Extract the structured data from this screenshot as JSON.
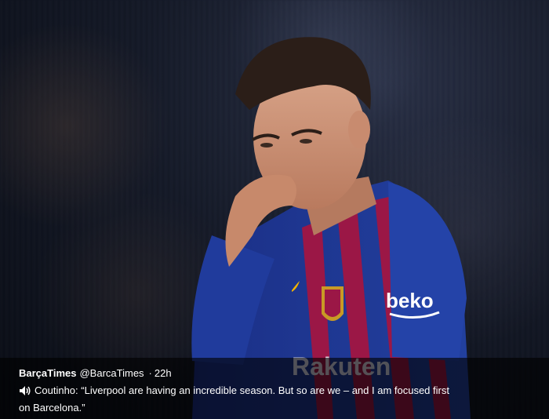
{
  "tweet": {
    "author_name": "BarçaTimes",
    "author_handle": "@BarcaTimes",
    "separator": "·",
    "time": "22h",
    "caption": "Coutinho: “Liverpool are having an incredible season. But so are we – and I am focused first on Barcelona.”"
  },
  "media": {
    "jersey_sponsor": "beko",
    "front_sponsor": "Rakuten",
    "icon": "speaker-icon",
    "colors": {
      "jersey_blue": "#1c3b9a",
      "jersey_red": "#a3174a",
      "overlay": "#000000"
    }
  }
}
